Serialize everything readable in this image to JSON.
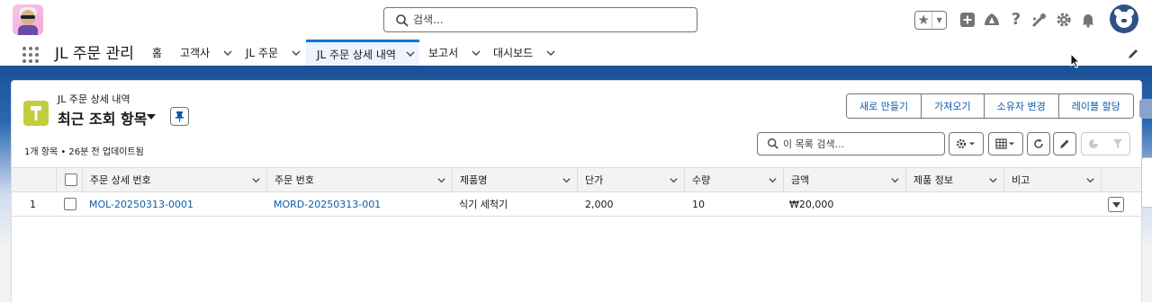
{
  "header": {
    "search_placeholder": "검색...",
    "icons": [
      "favorites-star-icon",
      "add-icon",
      "trailhead-icon",
      "help-icon",
      "setup-assistant-icon",
      "settings-gear-icon",
      "notification-bell-icon"
    ]
  },
  "nav": {
    "app_name": "JL 주문 관리",
    "items": [
      {
        "label": "홈"
      },
      {
        "label": "고객사"
      },
      {
        "label": "JL 주문"
      },
      {
        "label": "JL 주문 상세 내역",
        "active": true
      },
      {
        "label": "보고서"
      },
      {
        "label": "대시보드"
      }
    ]
  },
  "list": {
    "object_name": "JL 주문 상세 내역",
    "view_name": "최근 조회 항목",
    "meta": "1개 항목 • 26분 전 업데이트됨",
    "search_placeholder": "이 목록 검색...",
    "actions": [
      {
        "label": "새로 만들기"
      },
      {
        "label": "가져오기"
      },
      {
        "label": "소유자 변경"
      },
      {
        "label": "레이블 할당"
      }
    ],
    "accent": "#c2cc3d"
  },
  "table": {
    "columns": [
      "주문 상세 번호",
      "주문 번호",
      "제품명",
      "단가",
      "수량",
      "금액",
      "제품 정보",
      "비고"
    ],
    "rows": [
      {
        "index": "1",
        "detail_no": "MOL-20250313-0001",
        "order_no": "MORD-20250313-001",
        "product": "식기 세척기",
        "unit_price": "2,000",
        "qty": "10",
        "amount": "₩20,000",
        "product_info": "",
        "note": ""
      }
    ]
  },
  "colors": {
    "brand_blue": "#1b5297",
    "link": "#0b5cab",
    "active_tab_bar": "#0176d3"
  }
}
